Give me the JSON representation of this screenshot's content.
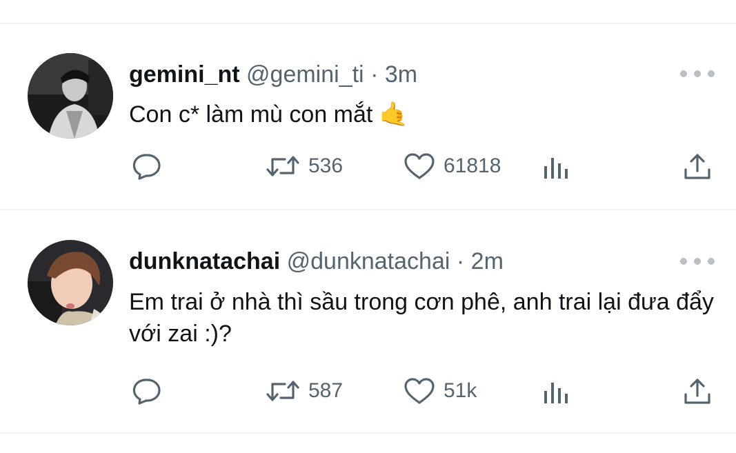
{
  "tweets": [
    {
      "display_name": "gemini_nt",
      "handle": "@gemini_ti",
      "separator": "·",
      "time": "3m",
      "text": "Con c* làm mù con mắt",
      "emoji": "🤙",
      "retweets": "536",
      "likes": "61818"
    },
    {
      "display_name": "dunknatachai",
      "handle": "@dunknatachai",
      "separator": "·",
      "time": "2m",
      "text": "Em trai ở nhà thì sầu trong cơn phê, anh trai lại đưa đẩy với zai :)?",
      "emoji": "",
      "retweets": "587",
      "likes": "51k"
    }
  ],
  "icons": {
    "reply": "reply-icon",
    "retweet": "retweet-icon",
    "like": "heart-icon",
    "views": "views-icon",
    "share": "share-icon",
    "more": "more-icon"
  },
  "colors": {
    "text": "#0f1419",
    "secondary": "#536471",
    "divider": "#eff3f4"
  }
}
